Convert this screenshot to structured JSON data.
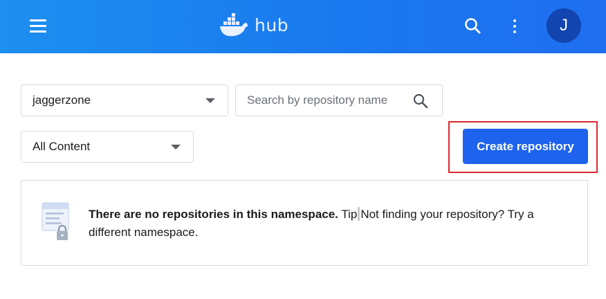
{
  "header": {
    "logo_text": "hub",
    "avatar_initial": "J",
    "colors": {
      "bar_start": "#1d8ff0",
      "bar_end": "#1f6ef0",
      "avatar": "#1245b0"
    },
    "icons": [
      "menu-icon",
      "docker-whale-icon",
      "search-icon",
      "more-vertical-icon"
    ]
  },
  "filters": {
    "namespace_value": "jaggerzone",
    "search_placeholder": "Search by repository name",
    "content_value": "All Content"
  },
  "actions": {
    "create_label": "Create repository",
    "create_color": "#1d63ed",
    "highlight_color": "#e0262d"
  },
  "empty_state": {
    "bold_text": "There are no repositories in this namespace.",
    "tip_label": "Tip",
    "tip_text": "Not finding your repository? Try a different namespace."
  }
}
